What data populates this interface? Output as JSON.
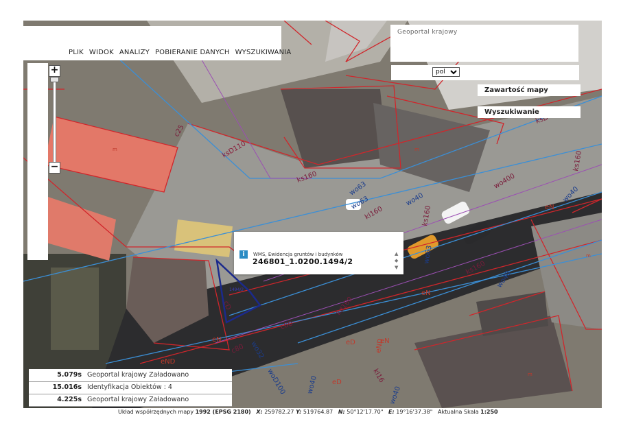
{
  "menu": {
    "items": [
      "PLIK",
      "WIDOK",
      "ANALIZY",
      "POBIERANIE DANYCH",
      "WYSZUKIWANIA"
    ]
  },
  "zoom": {
    "in_label": "+",
    "out_label": "−"
  },
  "right_panel": {
    "title": "Geoportal krajowy",
    "language": {
      "selected": "pol",
      "options": [
        "pol"
      ]
    },
    "map_contents_button": "Zawartość mapy",
    "search_button": "Wyszukiwanie"
  },
  "info_popup": {
    "icon": "i",
    "layer": "WMS, Ewidencja gruntów i budynków",
    "parcel_id": "246801_1.0200.1494/2",
    "scroll_up": "▲",
    "scroll_mid": "◆",
    "scroll_down": "▼"
  },
  "status_log": [
    {
      "time": "5.079s",
      "description": "Geoportal krajowy  Załadowano"
    },
    {
      "time": "15.016s",
      "description": "Identyfikacja  Obiektów : 4"
    },
    {
      "time": "4.225s",
      "description": "Geoportal krajowy  Załadowano"
    }
  ],
  "coordinates": {
    "system_prefix": "Układ współrzędnych mapy",
    "system_value": "1992 (EPSG 2180)",
    "x_label": "X:",
    "x_value": "259782.27",
    "y_label": "Y:",
    "y_value": "519764.87",
    "n_label": "N:",
    "n_value": "50°12'17.70\"",
    "e_label": "E:",
    "e_value": "19°16'37.38\"",
    "scale_prefix": "Aktualna Skala",
    "scale_value": "1:250"
  },
  "map_labels": {
    "parcel_1494": "1494/2",
    "ksD110": "ksD110",
    "ks160_a": "ks160",
    "ks160_b": "ks160",
    "ks160_c": "ks160",
    "ks160_d": "ks160",
    "wo63_a": "wo63",
    "wo63_b": "wo63",
    "wo63_c": "wo63",
    "kl160": "kl160",
    "wo40_a": "wo40",
    "wo40_b": "wo40",
    "wo40_c": "wo40",
    "wo40_d": "wo40",
    "wo40_e": "wo40",
    "wo400": "wo400",
    "wo32": "wo32",
    "woD100": "woD100",
    "kd160": "kd160",
    "kl16": "kl16",
    "ksD": "ksD",
    "c80_a": "c80",
    "c80_b": "c80",
    "eN_a": "eN",
    "eN_b": "eN",
    "eN_c": "eN",
    "eN_d": "eN",
    "eND_a": "eND",
    "eND_b": "eND",
    "eD_a": "eD",
    "eD_b": "eD",
    "cD": "cD",
    "c25": "c25",
    "m_a": "m",
    "m_b": "m",
    "m_c": "m",
    "m_d": "m"
  },
  "colors": {
    "parcel_line": "#d0262b",
    "selected_parcel": "#1b2a8c",
    "utility_blue": "#3b8fd6",
    "utility_purple": "#9b4fb3",
    "road": "#8d8c88",
    "roof_red": "#e57a6a",
    "roof_dark": "#5b5350"
  }
}
